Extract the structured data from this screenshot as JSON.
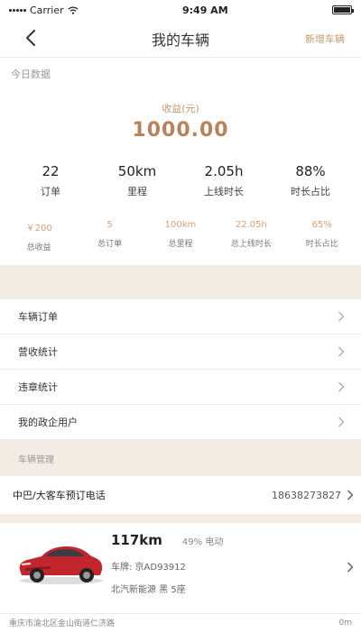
{
  "status_bar": {
    "carrier": "Carrier",
    "time": "9:49 AM",
    "battery_level": 1.0
  },
  "nav": {
    "title": "我的车辆",
    "action_label": "新增车辆"
  },
  "today_section_label": "今日数据",
  "earnings": {
    "label": "收益(元)",
    "value": "1000.00"
  },
  "stats": [
    {
      "value": "22",
      "label": "订单"
    },
    {
      "value": "50km",
      "label": "里程"
    },
    {
      "value": "2.05h",
      "label": "上线时长"
    },
    {
      "value": "88%",
      "label": "时长占比"
    }
  ],
  "totals": [
    {
      "value": "￥200",
      "label": "总收益"
    },
    {
      "value": "5",
      "label": "总订单"
    },
    {
      "value": "100km",
      "label": "总里程"
    },
    {
      "value": "22.05h",
      "label": "总上线时长"
    },
    {
      "value": "65%",
      "label": "时长占比"
    }
  ],
  "menu": [
    {
      "label": "车辆订单"
    },
    {
      "label": "营收统计"
    },
    {
      "label": "违章统计"
    },
    {
      "label": "我的政企用户"
    }
  ],
  "vehicle_section_label": "车辆管理",
  "contact": {
    "label": "中巴/大客车预订电话",
    "phone": "18638273827"
  },
  "vehicle": {
    "mileage": "117km",
    "battery": "49% 电动",
    "plate": "车牌: 京AD93912",
    "model": "北汽新能源  黑 5座",
    "location": "重庆市渝北区金山街道仁济路",
    "distance": "0m"
  },
  "colors": {
    "accent": "#c59a6e",
    "band": "#f3ece5",
    "car_body": "#c2262c"
  }
}
